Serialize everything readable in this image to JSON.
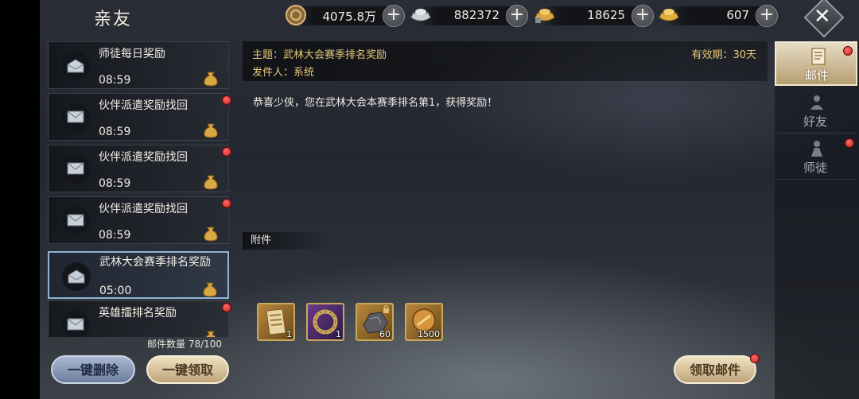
{
  "header": {
    "title": "亲友"
  },
  "resources": [
    {
      "icon": "copper-coin-icon",
      "value": "4075.8万"
    },
    {
      "icon": "silver-ingot-icon",
      "value": "882372"
    },
    {
      "icon": "locked-gold-ingot-icon",
      "value": "18625"
    },
    {
      "icon": "gold-ingot-icon",
      "value": "607"
    }
  ],
  "mail_list": [
    {
      "title": "师徒每日奖励",
      "time": "08:59",
      "unread": false,
      "opened": true,
      "selected": false
    },
    {
      "title": "伙伴派遣奖励找回",
      "time": "08:59",
      "unread": true,
      "opened": false,
      "selected": false
    },
    {
      "title": "伙伴派遣奖励找回",
      "time": "08:59",
      "unread": true,
      "opened": false,
      "selected": false
    },
    {
      "title": "伙伴派遣奖励找回",
      "time": "08:59",
      "unread": true,
      "opened": false,
      "selected": false
    },
    {
      "title": "武林大会赛季排名奖励",
      "time": "05:00",
      "unread": false,
      "opened": true,
      "selected": true
    },
    {
      "title": "英雄擂排名奖励",
      "time": "",
      "unread": true,
      "opened": false,
      "selected": false
    }
  ],
  "mail_count": "邮件数量 78/100",
  "buttons": {
    "delete_all": "一键删除",
    "claim_all": "一键领取",
    "claim_mail": "领取邮件"
  },
  "mail_detail": {
    "subject": "主题：武林大会赛季排名奖励",
    "sender": "发件人：系统",
    "validity": "有效期：30天",
    "body": "恭喜少侠，您在武林大会本赛季排名第1，获得奖励！",
    "attachments_label": "附件",
    "attachments": [
      {
        "icon": "scroll-item-icon",
        "qty": "1",
        "locked": false
      },
      {
        "icon": "bracelet-item-icon",
        "qty": "1",
        "locked": false
      },
      {
        "icon": "ore-item-icon",
        "qty": "60",
        "locked": true
      },
      {
        "icon": "coin-item-icon",
        "qty": "1500",
        "locked": false
      }
    ]
  },
  "tabs": [
    {
      "label": "邮件",
      "active": true,
      "badge": true
    },
    {
      "label": "好友",
      "active": false,
      "badge": false
    },
    {
      "label": "师徒",
      "active": false,
      "badge": true
    }
  ],
  "colors": {
    "accent_gold": "#e6c87a",
    "badge_red": "#d52424",
    "selection_blue": "#8fb4d6"
  }
}
